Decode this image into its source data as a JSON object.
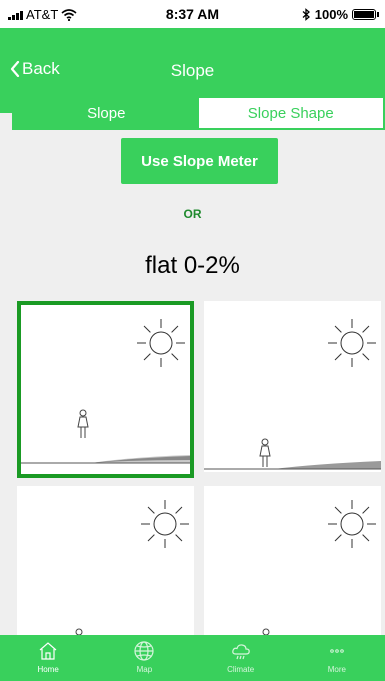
{
  "status_bar": {
    "carrier": "AT&T",
    "time": "8:37 AM",
    "battery": "100%",
    "icons": [
      "signal-icon",
      "wifi-icon",
      "bluetooth-icon",
      "battery-icon"
    ]
  },
  "nav": {
    "back_label": "Back",
    "title": "Slope"
  },
  "segments": {
    "slope": "Slope",
    "slope_shape": "Slope Shape",
    "selected": "Slope"
  },
  "main": {
    "meter_button": "Use Slope Meter",
    "or_label": "OR",
    "slope_value": "flat 0-2%"
  },
  "tiles": [
    {
      "name": "tile-flat-left",
      "selected": true,
      "icons": [
        "sun-icon",
        "person-icon"
      ]
    },
    {
      "name": "tile-flat-right",
      "selected": false,
      "icons": [
        "sun-icon",
        "person-icon"
      ]
    },
    {
      "name": "tile-slope-left",
      "selected": false,
      "icons": [
        "sun-icon",
        "person-icon"
      ]
    },
    {
      "name": "tile-slope-right",
      "selected": false,
      "icons": [
        "sun-icon",
        "person-icon"
      ]
    }
  ],
  "tab_bar": {
    "tabs": [
      {
        "label": "Home",
        "icon": "home-icon",
        "active": true
      },
      {
        "label": "Map",
        "icon": "globe-icon",
        "active": false
      },
      {
        "label": "Climate",
        "icon": "cloud-rain-icon",
        "active": false
      },
      {
        "label": "More",
        "icon": "more-icon",
        "active": false
      }
    ]
  },
  "colors": {
    "accent": "#39d05c",
    "selected_border": "#1a9a24",
    "or_text": "#1f8a2e"
  }
}
